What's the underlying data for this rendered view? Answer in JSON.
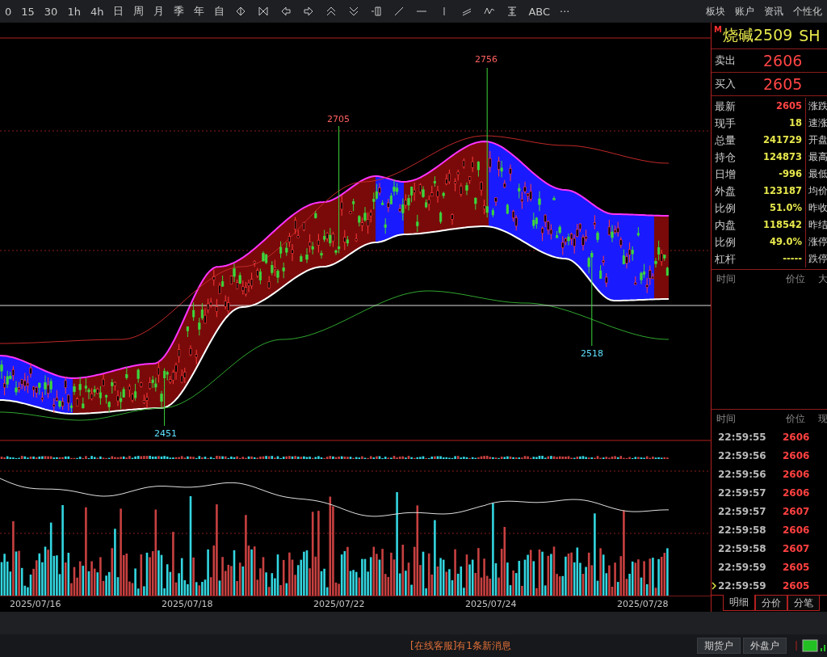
{
  "toolbar": {
    "periods": [
      "0",
      "15",
      "30",
      "1h",
      "4h",
      "日",
      "周",
      "月",
      "季",
      "年",
      "自"
    ],
    "text_tools": [
      "ABC",
      "···"
    ],
    "menu": [
      "板块",
      "账户",
      "资讯",
      "个性化"
    ]
  },
  "chart": {
    "labels": [
      {
        "text": "2756",
        "kind": "high"
      },
      {
        "text": "2705",
        "kind": "high"
      },
      {
        "text": "2451",
        "kind": "low"
      },
      {
        "text": "2518",
        "kind": "low"
      }
    ],
    "dates": [
      "2025/07/16",
      "2025/07/18",
      "2025/07/22",
      "2025/07/24",
      "2025/07/28"
    ]
  },
  "quote": {
    "badge": "M",
    "symbol": "烧碱2509",
    "exchange": "SH",
    "sell": {
      "label": "卖出",
      "price": "2606"
    },
    "buy": {
      "label": "买入",
      "price": "2605"
    },
    "stats": [
      {
        "label": "最新",
        "value": "2605",
        "color": "#ff4444",
        "right_label": "涨跌"
      },
      {
        "label": "现手",
        "value": "18",
        "color": "#e6e64c",
        "right_label": "速涨"
      },
      {
        "label": "总量",
        "value": "241729",
        "color": "#e6e64c",
        "right_label": "开盘"
      },
      {
        "label": "持仓",
        "value": "124873",
        "color": "#e6e64c",
        "right_label": "最高"
      },
      {
        "label": "日增",
        "value": "-996",
        "color": "#e6e64c",
        "right_label": "最低"
      },
      {
        "label": "外盘",
        "value": "123187",
        "color": "#e6e64c",
        "right_label": "均价"
      },
      {
        "label": "比例",
        "value": "51.0%",
        "color": "#e6e64c",
        "right_label": "昨收"
      },
      {
        "label": "内盘",
        "value": "118542",
        "color": "#e6e64c",
        "right_label": "昨结"
      },
      {
        "label": "比例",
        "value": "49.0%",
        "color": "#e6e64c",
        "right_label": "涨停"
      },
      {
        "label": "杠杆",
        "value": "-----",
        "color": "#e6e64c",
        "right_label": "跌停"
      }
    ],
    "upper_list_header": [
      "时间",
      "价位",
      "大"
    ],
    "lower_list_header": [
      "时间",
      "价位",
      "现"
    ],
    "ticks": [
      {
        "time": "22:59:55",
        "price": "2606",
        "current": false
      },
      {
        "time": "22:59:56",
        "price": "2606",
        "current": false
      },
      {
        "time": "22:59:56",
        "price": "2606",
        "current": false
      },
      {
        "time": "22:59:57",
        "price": "2606",
        "current": false
      },
      {
        "time": "22:59:57",
        "price": "2607",
        "current": false
      },
      {
        "time": "22:59:58",
        "price": "2606",
        "current": false
      },
      {
        "time": "22:59:58",
        "price": "2607",
        "current": false
      },
      {
        "time": "22:59:59",
        "price": "2605",
        "current": false
      },
      {
        "time": "22:59:59",
        "price": "2605",
        "current": true
      }
    ],
    "tabs": [
      {
        "label": "明细",
        "selected": true
      },
      {
        "label": "分价",
        "selected": false
      },
      {
        "label": "分笔",
        "selected": false
      }
    ]
  },
  "status": {
    "message": "[在线客服]有1条新消息",
    "buttons": [
      "期货户",
      "外盘户"
    ]
  }
}
